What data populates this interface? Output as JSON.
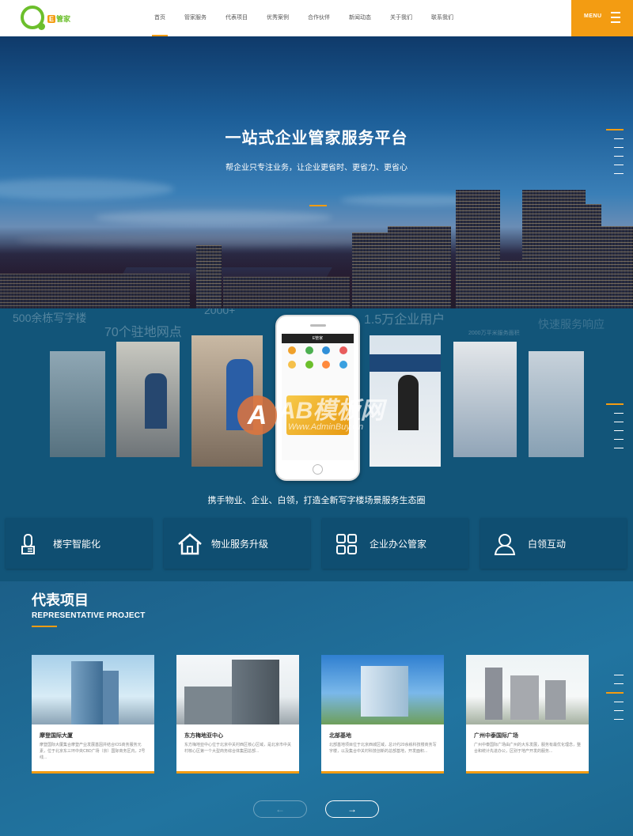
{
  "header": {
    "logo_text": "E管家",
    "nav": [
      "首页",
      "管家服务",
      "代表项目",
      "优秀案例",
      "合作伙伴",
      "新闻动态",
      "关于我们",
      "联系我们"
    ],
    "menu_label": "MENU"
  },
  "hero": {
    "title": "一站式企业管家服务平台",
    "subtitle": "帮企业只专注业务，让企业更省时、更省力、更省心"
  },
  "ecosystem": {
    "bg_texts": [
      "500余栋写字楼",
      "70个驻地网点",
      "2000+",
      "1.5万企业用户",
      "2000万平米服务面积",
      "快速服务响应"
    ],
    "phone_title": "E管家",
    "watermark_text": "AB模板网",
    "watermark_url": "Www.AdminBuy.Cn",
    "caption": "携手物业、企业、白领，打造全新写字楼场景服务生态圈",
    "features": [
      {
        "label": "楼宇智能化",
        "icon": "building-device-icon"
      },
      {
        "label": "物业服务升级",
        "icon": "home-icon"
      },
      {
        "label": "企业办公管家",
        "icon": "grid-icon"
      },
      {
        "label": "白领互动",
        "icon": "user-icon"
      }
    ]
  },
  "projects": {
    "title": "代表项目",
    "subtitle_en": "REPRESENTATIVE PROJECT",
    "items": [
      {
        "name": "摩登国际大厦",
        "desc": "摩登国际大厦集合摩登产业发展基因并结合IOS商务服务元素，位于北京东三环中央CBD广场（京）国际商务区内，2号线..."
      },
      {
        "name": "东方梅地亚中心",
        "desc": "东方梅地亚中心位于北京中关村西区核心区域，是北京市中关村核心区第一个大型商务综合体集团总部..."
      },
      {
        "name": "北部基地",
        "desc": "北部基地项目位于北京西城区域，总计约20余栋科技楼商务写字楼，以及集合中关村科技创新的总部基地，开发面积..."
      },
      {
        "name": "广州中泰国际广场",
        "desc": "广州中泰国际广场由广州的大东发展，服务有最优化理念，整合和统计先进办公，区别于地产开发的服务..."
      }
    ],
    "prev_label": "←",
    "next_label": "→"
  }
}
